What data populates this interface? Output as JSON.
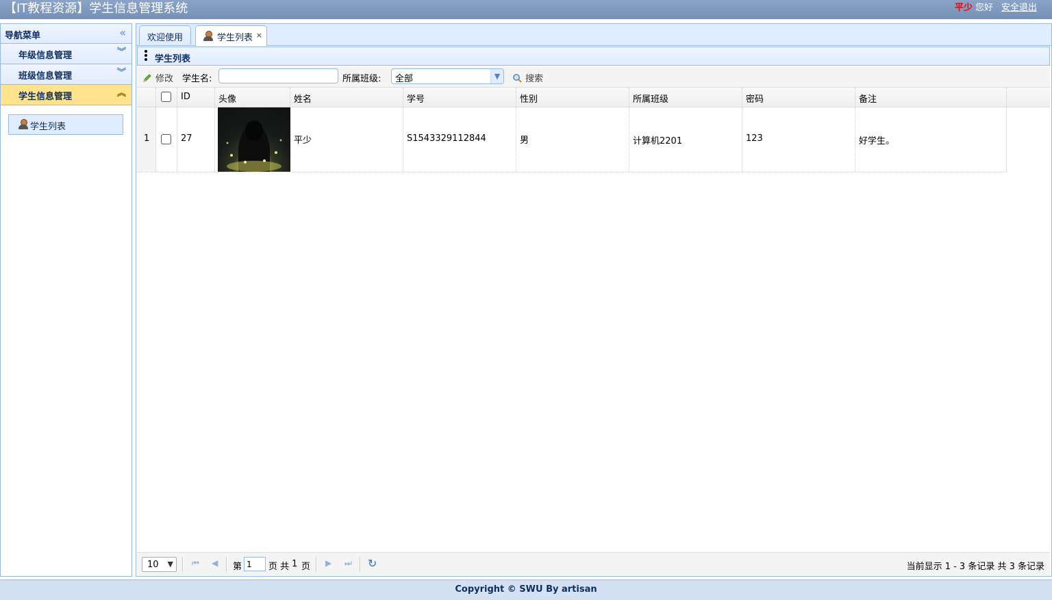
{
  "header": {
    "title": "【IT教程资源】学生信息管理系统",
    "user_name": "平少",
    "greeting": "您好",
    "logout": "安全退出"
  },
  "nav": {
    "title": "导航菜单",
    "items": [
      {
        "label": "年级信息管理",
        "expanded": false
      },
      {
        "label": "班级信息管理",
        "expanded": false
      },
      {
        "label": "学生信息管理",
        "expanded": true
      }
    ],
    "sub_item": "学生列表"
  },
  "tabs": [
    {
      "label": "欢迎使用",
      "selected": false
    },
    {
      "label": "学生列表",
      "selected": true,
      "close": "×"
    }
  ],
  "panel": {
    "title": "学生列表"
  },
  "toolbar": {
    "edit_label": "修改",
    "name_label": "学生名:",
    "name_value": "",
    "class_label": "所属班级:",
    "class_value": "全部",
    "search_label": "搜索"
  },
  "grid": {
    "columns": [
      "ID",
      "头像",
      "姓名",
      "学号",
      "性别",
      "所属班级",
      "密码",
      "备注"
    ],
    "rows": [
      {
        "row_num": "1",
        "id": "27",
        "name": "平少",
        "student_no": "S1543329112844",
        "gender": "男",
        "class_name": "计算机2201",
        "password": "123",
        "remark": "好学生。"
      }
    ]
  },
  "pager": {
    "page_size": "10",
    "page_label_before": "第",
    "current_page": "1",
    "page_label_after": "页 共",
    "total_pages": "1",
    "page_label_end": "页",
    "info": "当前显示 1 - 3 条记录 共 3 条记录"
  },
  "footer": {
    "copyright": "Copyright © SWU By artisan"
  },
  "colors": {
    "header_bg": "#7f99be",
    "accent": "#95b8e7",
    "active_nav": "#ffe48d",
    "user_name": "#ff0000"
  }
}
